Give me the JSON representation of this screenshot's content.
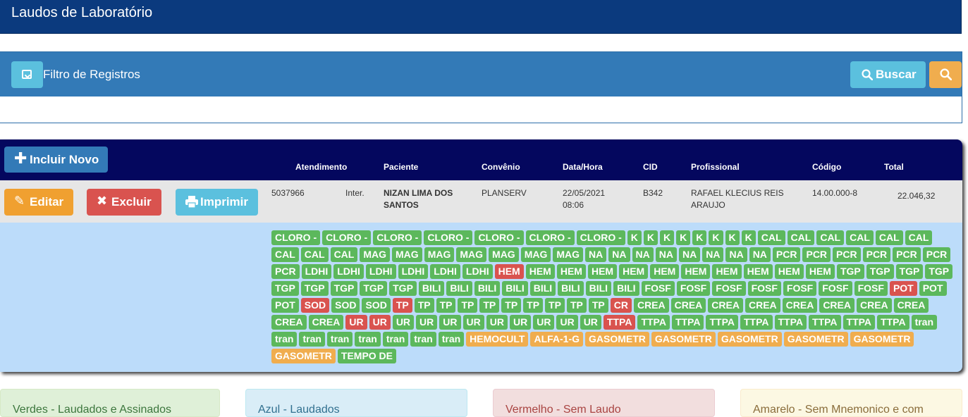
{
  "page": {
    "title": "Laudos de Laboratório"
  },
  "filter": {
    "title": "Filtro de Registros",
    "search_label": "Buscar"
  },
  "grid": {
    "new_label": "Incluir Novo",
    "columns": {
      "atendimento": "Atendimento",
      "paciente": "Paciente",
      "convenio": "Convênio",
      "datahora": "Data/Hora",
      "cid": "CID",
      "profissional": "Profissional",
      "codigo": "Código",
      "total": "Total"
    },
    "row": {
      "edit_label": "Editar",
      "delete_label": "Excluir",
      "print_label": "Imprimir",
      "atendimento": "5037966",
      "tipo": "Inter.",
      "paciente_line1": "NIZAN LIMA DOS",
      "paciente_line2": "SANTOS",
      "convenio": "PLANSERV",
      "data": "22/05/2021",
      "hora": "08:06",
      "cid": "B342",
      "profissional_line1": "RAFAEL KLECIUS REIS",
      "profissional_line2": "ARAUJO",
      "codigo": "14.00.000-8",
      "total": "22.046,32"
    },
    "exams": [
      {
        "label": "CLORO -",
        "status": "green"
      },
      {
        "label": "CLORO -",
        "status": "green"
      },
      {
        "label": "CLORO -",
        "status": "green"
      },
      {
        "label": "CLORO -",
        "status": "green"
      },
      {
        "label": "CLORO -",
        "status": "green"
      },
      {
        "label": "CLORO -",
        "status": "green"
      },
      {
        "label": "CLORO -",
        "status": "green"
      },
      {
        "label": "K",
        "status": "green"
      },
      {
        "label": "K",
        "status": "green"
      },
      {
        "label": "K",
        "status": "green"
      },
      {
        "label": "K",
        "status": "green"
      },
      {
        "label": "K",
        "status": "green"
      },
      {
        "label": "K",
        "status": "green"
      },
      {
        "label": "K",
        "status": "green"
      },
      {
        "label": "K",
        "status": "green"
      },
      {
        "label": "CAL",
        "status": "green"
      },
      {
        "label": "CAL",
        "status": "green"
      },
      {
        "label": "CAL",
        "status": "green"
      },
      {
        "label": "CAL",
        "status": "green"
      },
      {
        "label": "CAL",
        "status": "green"
      },
      {
        "label": "CAL",
        "status": "green"
      },
      {
        "label": "CAL",
        "status": "green"
      },
      {
        "label": "CAL",
        "status": "green"
      },
      {
        "label": "CAL",
        "status": "green"
      },
      {
        "label": "MAG",
        "status": "green"
      },
      {
        "label": "MAG",
        "status": "green"
      },
      {
        "label": "MAG",
        "status": "green"
      },
      {
        "label": "MAG",
        "status": "green"
      },
      {
        "label": "MAG",
        "status": "green"
      },
      {
        "label": "MAG",
        "status": "green"
      },
      {
        "label": "MAG",
        "status": "green"
      },
      {
        "label": "NA",
        "status": "green"
      },
      {
        "label": "NA",
        "status": "green"
      },
      {
        "label": "NA",
        "status": "green"
      },
      {
        "label": "NA",
        "status": "green"
      },
      {
        "label": "NA",
        "status": "green"
      },
      {
        "label": "NA",
        "status": "green"
      },
      {
        "label": "NA",
        "status": "green"
      },
      {
        "label": "NA",
        "status": "green"
      },
      {
        "label": "PCR",
        "status": "green"
      },
      {
        "label": "PCR",
        "status": "green"
      },
      {
        "label": "PCR",
        "status": "green"
      },
      {
        "label": "PCR",
        "status": "green"
      },
      {
        "label": "PCR",
        "status": "green"
      },
      {
        "label": "PCR",
        "status": "green"
      },
      {
        "label": "PCR",
        "status": "green"
      },
      {
        "label": "LDHI",
        "status": "green"
      },
      {
        "label": "LDHI",
        "status": "green"
      },
      {
        "label": "LDHI",
        "status": "green"
      },
      {
        "label": "LDHI",
        "status": "green"
      },
      {
        "label": "LDHI",
        "status": "green"
      },
      {
        "label": "LDHI",
        "status": "green"
      },
      {
        "label": "HEM",
        "status": "red"
      },
      {
        "label": "HEM",
        "status": "green"
      },
      {
        "label": "HEM",
        "status": "green"
      },
      {
        "label": "HEM",
        "status": "green"
      },
      {
        "label": "HEM",
        "status": "green"
      },
      {
        "label": "HEM",
        "status": "green"
      },
      {
        "label": "HEM",
        "status": "green"
      },
      {
        "label": "HEM",
        "status": "green"
      },
      {
        "label": "HEM",
        "status": "green"
      },
      {
        "label": "HEM",
        "status": "green"
      },
      {
        "label": "HEM",
        "status": "green"
      },
      {
        "label": "TGP",
        "status": "green"
      },
      {
        "label": "TGP",
        "status": "green"
      },
      {
        "label": "TGP",
        "status": "green"
      },
      {
        "label": "TGP",
        "status": "green"
      },
      {
        "label": "TGP",
        "status": "green"
      },
      {
        "label": "TGP",
        "status": "green"
      },
      {
        "label": "TGP",
        "status": "green"
      },
      {
        "label": "TGP",
        "status": "green"
      },
      {
        "label": "TGP",
        "status": "green"
      },
      {
        "label": "BILI",
        "status": "green"
      },
      {
        "label": "BILI",
        "status": "green"
      },
      {
        "label": "BILI",
        "status": "green"
      },
      {
        "label": "BILI",
        "status": "green"
      },
      {
        "label": "BILI",
        "status": "green"
      },
      {
        "label": "BILI",
        "status": "green"
      },
      {
        "label": "BILI",
        "status": "green"
      },
      {
        "label": "BILI",
        "status": "green"
      },
      {
        "label": "FOSF",
        "status": "green"
      },
      {
        "label": "FOSF",
        "status": "green"
      },
      {
        "label": "FOSF",
        "status": "green"
      },
      {
        "label": "FOSF",
        "status": "green"
      },
      {
        "label": "FOSF",
        "status": "green"
      },
      {
        "label": "FOSF",
        "status": "green"
      },
      {
        "label": "FOSF",
        "status": "green"
      },
      {
        "label": "POT",
        "status": "red"
      },
      {
        "label": "POT",
        "status": "green"
      },
      {
        "label": "POT",
        "status": "green"
      },
      {
        "label": "SOD",
        "status": "red"
      },
      {
        "label": "SOD",
        "status": "green"
      },
      {
        "label": "SOD",
        "status": "green"
      },
      {
        "label": "TP",
        "status": "red"
      },
      {
        "label": "TP",
        "status": "green"
      },
      {
        "label": "TP",
        "status": "green"
      },
      {
        "label": "TP",
        "status": "green"
      },
      {
        "label": "TP",
        "status": "green"
      },
      {
        "label": "TP",
        "status": "green"
      },
      {
        "label": "TP",
        "status": "green"
      },
      {
        "label": "TP",
        "status": "green"
      },
      {
        "label": "TP",
        "status": "green"
      },
      {
        "label": "TP",
        "status": "green"
      },
      {
        "label": "CR",
        "status": "red"
      },
      {
        "label": "CREA",
        "status": "green"
      },
      {
        "label": "CREA",
        "status": "green"
      },
      {
        "label": "CREA",
        "status": "green"
      },
      {
        "label": "CREA",
        "status": "green"
      },
      {
        "label": "CREA",
        "status": "green"
      },
      {
        "label": "CREA",
        "status": "green"
      },
      {
        "label": "CREA",
        "status": "green"
      },
      {
        "label": "CREA",
        "status": "green"
      },
      {
        "label": "CREA",
        "status": "green"
      },
      {
        "label": "CREA",
        "status": "green"
      },
      {
        "label": "UR",
        "status": "red"
      },
      {
        "label": "UR",
        "status": "red"
      },
      {
        "label": "UR",
        "status": "green"
      },
      {
        "label": "UR",
        "status": "green"
      },
      {
        "label": "UR",
        "status": "green"
      },
      {
        "label": "UR",
        "status": "green"
      },
      {
        "label": "UR",
        "status": "green"
      },
      {
        "label": "UR",
        "status": "green"
      },
      {
        "label": "UR",
        "status": "green"
      },
      {
        "label": "UR",
        "status": "green"
      },
      {
        "label": "UR",
        "status": "green"
      },
      {
        "label": "TTPA",
        "status": "red"
      },
      {
        "label": "TTPA",
        "status": "green"
      },
      {
        "label": "TTPA",
        "status": "green"
      },
      {
        "label": "TTPA",
        "status": "green"
      },
      {
        "label": "TTPA",
        "status": "green"
      },
      {
        "label": "TTPA",
        "status": "green"
      },
      {
        "label": "TTPA",
        "status": "green"
      },
      {
        "label": "TTPA",
        "status": "green"
      },
      {
        "label": "TTPA",
        "status": "green"
      },
      {
        "label": "tran",
        "status": "green"
      },
      {
        "label": "tran",
        "status": "green"
      },
      {
        "label": "tran",
        "status": "green"
      },
      {
        "label": "tran",
        "status": "green"
      },
      {
        "label": "tran",
        "status": "green"
      },
      {
        "label": "tran",
        "status": "green"
      },
      {
        "label": "tran",
        "status": "green"
      },
      {
        "label": "tran",
        "status": "green"
      },
      {
        "label": "HEMOCULT",
        "status": "orange"
      },
      {
        "label": "ALFA-1-G",
        "status": "orange"
      },
      {
        "label": "GASOMETR",
        "status": "orange"
      },
      {
        "label": "GASOMETR",
        "status": "orange"
      },
      {
        "label": "GASOMETR",
        "status": "orange"
      },
      {
        "label": "GASOMETR",
        "status": "orange"
      },
      {
        "label": "GASOMETR",
        "status": "orange"
      },
      {
        "label": "GASOMETR",
        "status": "orange"
      },
      {
        "label": "TEMPO DE",
        "status": "green"
      }
    ]
  },
  "legend": {
    "green": "Verdes - Laudados e Assinados",
    "blue": "Azul - Laudados",
    "red": "Vermelho - Sem Laudo",
    "yellow": "Amarelo - Sem Mnemonico e com"
  }
}
